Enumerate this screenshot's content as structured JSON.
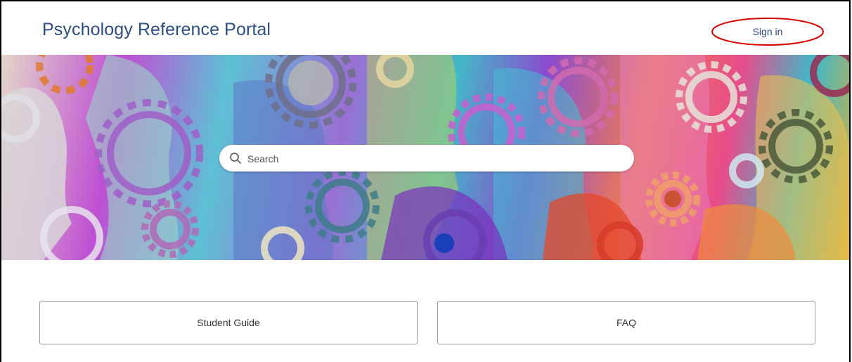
{
  "header": {
    "title": "Psychology Reference Portal",
    "sign_in_label": "Sign in"
  },
  "search": {
    "placeholder": "Search"
  },
  "cards": {
    "student_guide": "Student Guide",
    "faq": "FAQ"
  },
  "colors": {
    "title": "#2c4e86",
    "annotation": "#d90000",
    "card_border": "#9a9a9a"
  },
  "icons": {
    "search": "search-icon"
  }
}
